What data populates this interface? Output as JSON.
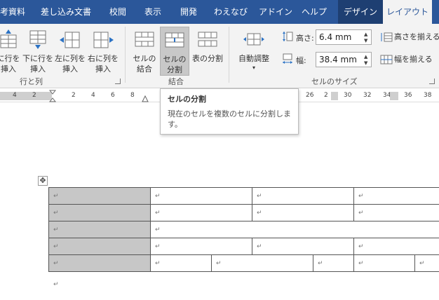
{
  "tabs": [
    {
      "label": "考資料"
    },
    {
      "label": "差し込み文書"
    },
    {
      "label": "校閲"
    },
    {
      "label": "表示"
    },
    {
      "label": "開発"
    },
    {
      "label": "わえなび"
    },
    {
      "label": "アドイン"
    },
    {
      "label": "ヘルプ"
    },
    {
      "label": "デザイン"
    },
    {
      "label": "レイアウト"
    }
  ],
  "ribbon": {
    "rows_cols": {
      "insert_above": "上に行を挿入",
      "insert_below": "下に行を挿入",
      "insert_left": "左に列を挿入",
      "insert_right": "右に列を挿入",
      "insert_above_line1": "に行を",
      "insert_above_line2": "挿入",
      "insert_below_line1": "下に行を",
      "insert_below_line2": "挿入",
      "insert_left_line1": "左に列を",
      "insert_left_line2": "挿入",
      "insert_right_line1": "右に列を",
      "insert_right_line2": "挿入",
      "group_label": "行と列"
    },
    "merge": {
      "merge_cells_line1": "セルの",
      "merge_cells_line2": "結合",
      "split_cells_line1": "セルの",
      "split_cells_line2": "分割",
      "split_table": "表の分割",
      "group_label": "結合"
    },
    "cell_size": {
      "autofit": "自動調整",
      "height_label": "高さ:",
      "height_value": "6.4 mm",
      "width_label": "幅:",
      "width_value": "38.4 mm",
      "distribute_rows": "高さを揃える",
      "distribute_cols": "幅を揃える",
      "group_label": "セルのサイズ"
    }
  },
  "ruler": {
    "left_numbers": [
      "4",
      "2"
    ],
    "right_numbers": [
      "2",
      "4",
      "6",
      "8"
    ],
    "far_numbers": [
      "26",
      "2",
      "30",
      "32",
      "34",
      "36",
      "38"
    ]
  },
  "tooltip": {
    "title": "セルの分割",
    "body": "現在のセルを複数のセルに分割します。"
  },
  "document": {
    "cell_mark": "↵",
    "move_handle": "✥"
  }
}
